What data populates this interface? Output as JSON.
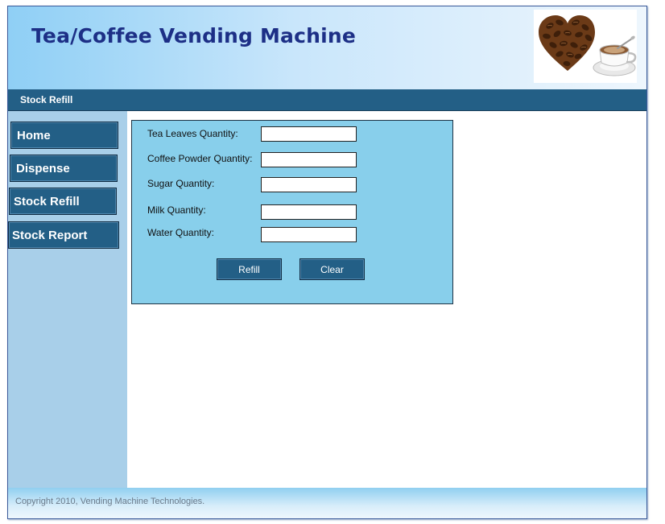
{
  "header": {
    "title": "Tea/Coffee Vending Machine",
    "logo_icon": "coffee-heart-logo"
  },
  "subheader": {
    "title": "Stock Refill"
  },
  "nav": [
    {
      "label": "Home"
    },
    {
      "label": "Dispense"
    },
    {
      "label": "Stock Refill"
    },
    {
      "label": "Stock Report"
    }
  ],
  "form": {
    "fields": [
      {
        "label": "Tea Leaves Quantity:",
        "value": ""
      },
      {
        "label": "Coffee Powder Quantity:",
        "value": ""
      },
      {
        "label": "Sugar Quantity:",
        "value": ""
      },
      {
        "label": "Milk Quantity:",
        "value": ""
      },
      {
        "label": "Water Quantity:",
        "value": ""
      }
    ],
    "refill_label": "Refill",
    "clear_label": "Clear"
  },
  "footer": {
    "copyright": "Copyright 2010, Vending Machine Technologies."
  },
  "colors": {
    "title": "#1d2f86",
    "nav_button": "#235f86",
    "panel": "#88cfeb",
    "sidebar": "#a8cfe9"
  }
}
